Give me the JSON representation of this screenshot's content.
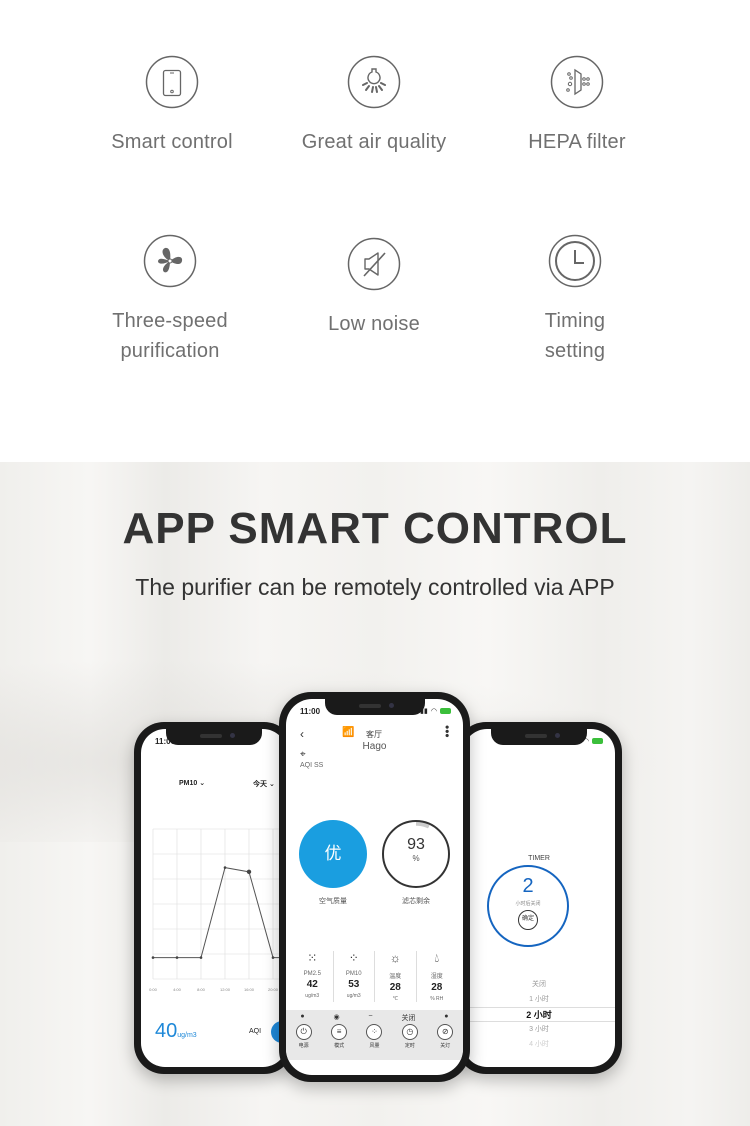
{
  "features": [
    {
      "icon": "smartphone-icon",
      "label": "Smart control"
    },
    {
      "icon": "lightbulb-icon",
      "label": "Great air quality"
    },
    {
      "icon": "hepa-filter-icon",
      "label": "HEPA filter"
    },
    {
      "icon": "fan-icon",
      "label": "Three-speed\npurification"
    },
    {
      "icon": "mute-speaker-icon",
      "label": "Low noise"
    },
    {
      "icon": "clock-icon",
      "label": "Timing\nsetting"
    }
  ],
  "app_section": {
    "title": "APP SMART CONTROL",
    "subtitle": "The purifier can be remotely controlled via APP"
  },
  "left_phone": {
    "time": "11:00",
    "metric_select": "PM10",
    "period_select": "今天",
    "current_value": "40",
    "current_unit": "ug/m3",
    "aqi_label": "AQI",
    "chart_data": {
      "type": "line",
      "x": [
        "0:00",
        "4:00",
        "8:00",
        "12:00",
        "16:00",
        "20:00"
      ],
      "values": [
        1,
        1,
        1,
        5.2,
        5,
        1
      ],
      "xlabel": "",
      "ylabel": "",
      "grid": true
    }
  },
  "center_phone": {
    "time": "11:00",
    "room": "客厅",
    "device_name": "Hago",
    "aqi_line": "AQI  SS",
    "air_quality_value": "优",
    "air_quality_caption": "空气质量",
    "filter_value": "93",
    "filter_unit": "%",
    "filter_caption": "滤芯剩余",
    "filter_remaining_percent": 93,
    "metrics": [
      {
        "icon": "pm25-icon",
        "name": "PM2.5",
        "value": "42",
        "unit": "ug/m3"
      },
      {
        "icon": "pm10-icon",
        "name": "PM10",
        "value": "53",
        "unit": "ug/m3"
      },
      {
        "icon": "sun-icon",
        "name": "温度",
        "value": "28",
        "unit": "℃"
      },
      {
        "icon": "droplet-icon",
        "name": "湿度",
        "value": "28",
        "unit": "% RH"
      }
    ],
    "status_row": [
      "●",
      "◉",
      "~",
      "关闭",
      "●"
    ],
    "controls": [
      {
        "icon": "power-icon",
        "glyph": "⏻",
        "label": "电源"
      },
      {
        "icon": "mode-icon",
        "glyph": "≡",
        "label": "模式"
      },
      {
        "icon": "fan-speed-icon",
        "glyph": "⁘",
        "label": "风量"
      },
      {
        "icon": "timer-icon",
        "glyph": "◷",
        "label": "定时"
      },
      {
        "icon": "light-off-icon",
        "glyph": "⊘",
        "label": "关灯"
      }
    ]
  },
  "right_phone": {
    "timer_label": "TIMER",
    "timer_value": "2",
    "timer_sub": "小时后关闭",
    "confirm_label": "确定",
    "picker_options": [
      "关闭",
      "1 小时",
      "2 小时",
      "3 小时",
      "4 小时"
    ],
    "picker_selected": "2 小时"
  },
  "colors": {
    "accent_blue": "#1a9ee0",
    "timer_blue": "#1565c0",
    "text_gray": "#707070"
  }
}
